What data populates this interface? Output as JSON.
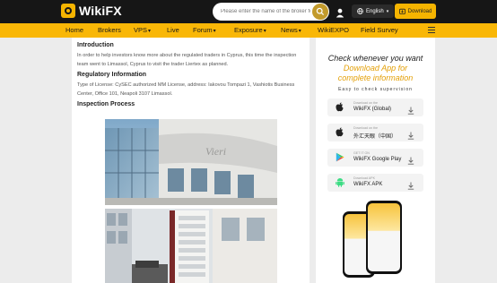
{
  "header": {
    "brand": "WikiFX",
    "search_placeholder": "Please enter the name of the broker for...",
    "language": "English",
    "download_label": "Download"
  },
  "nav": {
    "items": [
      {
        "label": "Home"
      },
      {
        "label": "Brokers"
      },
      {
        "label": "VPS"
      },
      {
        "label": "Live"
      },
      {
        "label": "Forum"
      },
      {
        "label": "Exposure"
      },
      {
        "label": "News"
      },
      {
        "label": "WikiEXPO"
      },
      {
        "label": "Field Survey"
      }
    ]
  },
  "article": {
    "intro_heading": "Introduction",
    "intro_text": "In order to help investors know more about the regulated traders in Cyprus, this time the inspection team went to Limassol, Cyprus to visit the trader Liertex as planned.",
    "reg_heading": "Regulatory Information",
    "reg_text": "Type of License: CySEC authorized MM License, address: Iakovou Tompazi 1, Vashiotis Business Center, Office 101, Neapoli 3107 Limassol.",
    "process_heading": "Inspection Process"
  },
  "sidebar": {
    "promo_line1": "Check whenever you want",
    "promo_line2": "Download App for",
    "promo_line3": "complete information",
    "promo_tagline": "Easy to check supervision",
    "stores": [
      {
        "sub": "Download on the",
        "name": "WikiFX (Global)",
        "icon": "apple-icon"
      },
      {
        "sub": "Download on the",
        "name": "外汇天眼（中国）",
        "icon": "apple-icon"
      },
      {
        "sub": "GET IT ON",
        "name": "WikiFX Google Play",
        "icon": "google-play-icon"
      },
      {
        "sub": "Download APK",
        "name": "WikiFX APK",
        "icon": "android-icon"
      }
    ]
  },
  "colors": {
    "header_bg": "#161616",
    "nav_bg": "#f9b707",
    "accent": "#f5b400",
    "promo_accent": "#e4a10a"
  }
}
